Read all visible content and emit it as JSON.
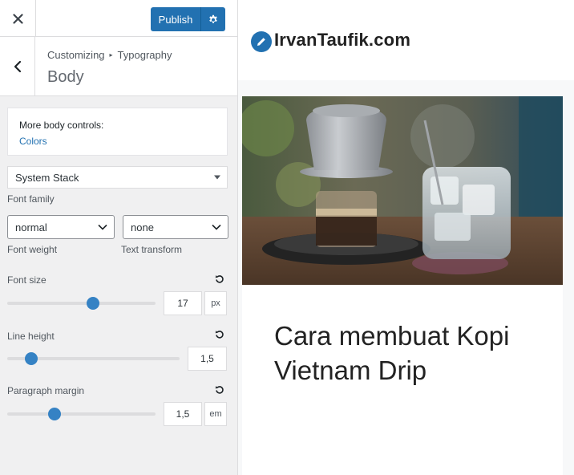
{
  "topbar": {
    "close_icon": "close-icon",
    "publish_label": "Publish",
    "settings_icon": "gear-icon"
  },
  "section": {
    "back_icon": "chevron-left-icon",
    "breadcrumb": {
      "root": "Customizing",
      "separator": "▸",
      "parent": "Typography"
    },
    "title": "Body"
  },
  "more_controls": {
    "title": "More body controls:",
    "link": "Colors"
  },
  "font_family": {
    "value": "System Stack",
    "label": "Font family"
  },
  "font_weight": {
    "value": "normal",
    "label": "Font weight"
  },
  "text_transform": {
    "value": "none",
    "label": "Text transform"
  },
  "font_size": {
    "label": "Font size",
    "value": "17",
    "unit": "px",
    "slider_fraction": 0.58
  },
  "line_height": {
    "label": "Line height",
    "value": "1,5",
    "slider_fraction": 0.14
  },
  "paragraph_margin": {
    "label": "Paragraph margin",
    "value": "1,5",
    "unit": "em",
    "slider_fraction": 0.32
  },
  "preview": {
    "site_title": "IrvanTaufik.com",
    "logo_icon": "pencil-icon",
    "post_title": "Cara membuat Kopi Vietnam Drip"
  },
  "colors": {
    "accent": "#2271b1",
    "slider_thumb": "#3582c4"
  }
}
